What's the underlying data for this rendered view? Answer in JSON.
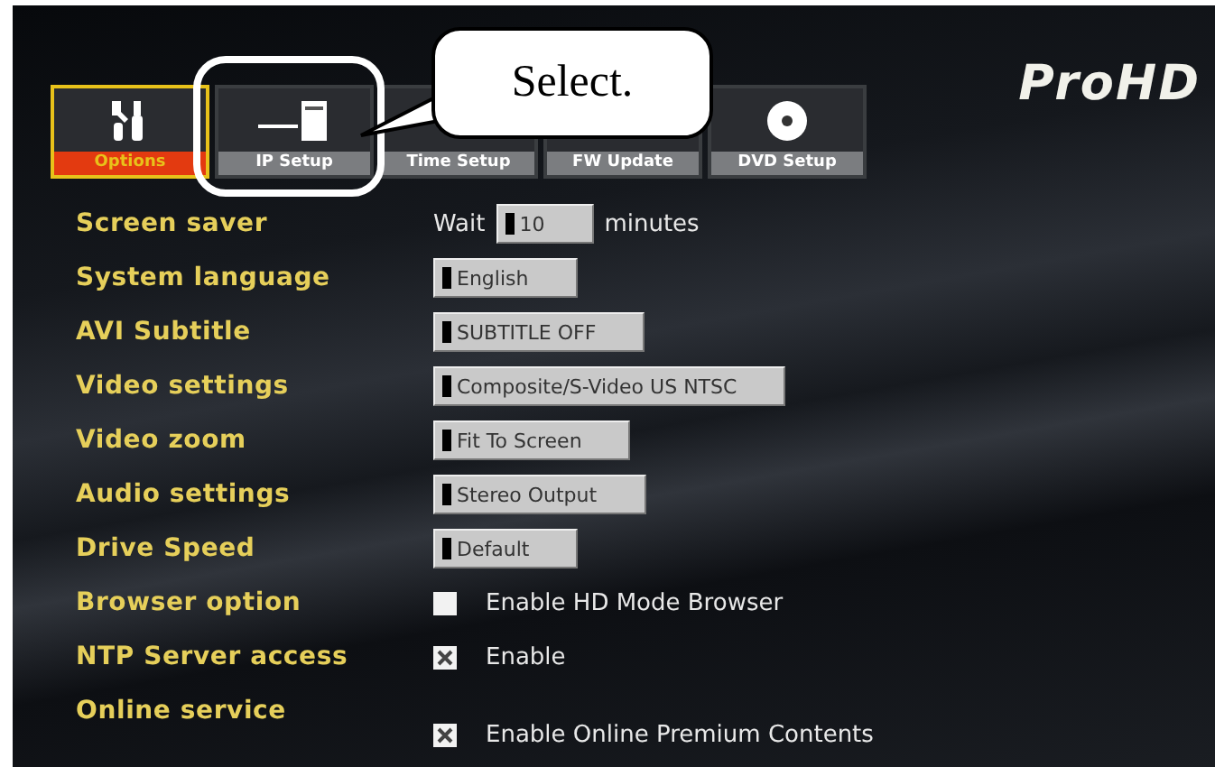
{
  "callout": {
    "text": "Select."
  },
  "tabs": [
    {
      "label": "Options",
      "selected": true
    },
    {
      "label": "IP Setup",
      "selected": false
    },
    {
      "label": "Time Setup",
      "selected": false
    },
    {
      "label": "FW Update",
      "selected": false
    },
    {
      "label": "DVD Setup",
      "selected": false
    }
  ],
  "logo": "ProHD",
  "settings": [
    {
      "label": "Screen saver",
      "kind": "dropdown",
      "prefix": "Wait",
      "value": "10",
      "suffix": "minutes"
    },
    {
      "label": "System language",
      "kind": "dropdown",
      "value": "English"
    },
    {
      "label": "AVI Subtitle",
      "kind": "dropdown",
      "value": "SUBTITLE OFF"
    },
    {
      "label": "Video settings",
      "kind": "dropdown",
      "value": "Composite/S-Video US NTSC"
    },
    {
      "label": "Video zoom",
      "kind": "dropdown",
      "value": "Fit To Screen"
    },
    {
      "label": "Audio settings",
      "kind": "dropdown",
      "value": "Stereo Output"
    },
    {
      "label": "Drive Speed",
      "kind": "dropdown",
      "value": "Default"
    },
    {
      "label": "Browser option",
      "kind": "checkbox",
      "checked": false,
      "text": "Enable HD Mode Browser"
    },
    {
      "label": "NTP Server access",
      "kind": "checkbox",
      "checked": true,
      "text": "Enable"
    },
    {
      "label": "Online service",
      "kind": "checkbox",
      "checked": true,
      "text": "Enable Online Premium Contents",
      "lower": true
    }
  ]
}
